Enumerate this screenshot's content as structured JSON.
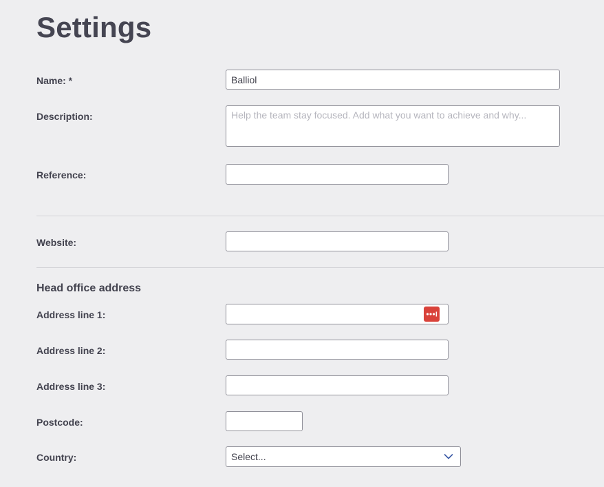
{
  "page": {
    "title": "Settings"
  },
  "form": {
    "name": {
      "label": "Name: *",
      "value": "Balliol"
    },
    "description": {
      "label": "Description:",
      "value": "",
      "placeholder": "Help the team stay focused. Add what you want to achieve and why..."
    },
    "reference": {
      "label": "Reference:",
      "value": ""
    },
    "website": {
      "label": "Website:",
      "value": ""
    }
  },
  "address": {
    "heading": "Head office address",
    "line1": {
      "label": "Address line 1:",
      "value": "",
      "password_manager_icon": "lastpass-dots-icon"
    },
    "line2": {
      "label": "Address line 2:",
      "value": ""
    },
    "line3": {
      "label": "Address line 3:",
      "value": ""
    },
    "postcode": {
      "label": "Postcode:",
      "value": ""
    },
    "country": {
      "label": "Country:",
      "selected": "Select...",
      "icon": "chevron-down-icon"
    }
  },
  "colors": {
    "background": "#eeeef0",
    "text": "#3f3f4a",
    "field_border": "#8f8f98",
    "badge": "#d9423a",
    "chevron": "#3b5aa6"
  }
}
